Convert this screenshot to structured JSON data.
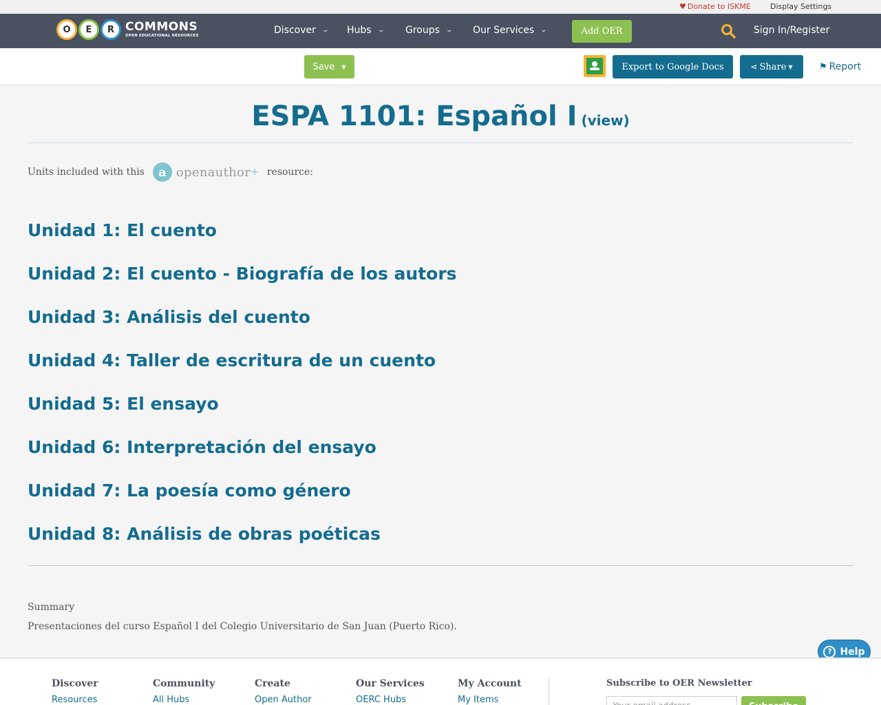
{
  "utility": {
    "donate": "Donate to ISKME",
    "display_settings": "Display Settings"
  },
  "logo": {
    "letters": [
      "O",
      "E",
      "R"
    ],
    "wordmark": "COMMONS",
    "tagline": "OPEN EDUCATIONAL RESOURCES"
  },
  "nav": {
    "items": [
      {
        "label": "Discover"
      },
      {
        "label": "Hubs"
      },
      {
        "label": "Groups"
      },
      {
        "label": "Our Services"
      }
    ],
    "add_oer": "Add OER",
    "signin": "Sign In/Register"
  },
  "toolbar": {
    "save": "Save",
    "export": "Export to Google Docs",
    "share": "Share",
    "report": "Report"
  },
  "page": {
    "title": "ESPA 1101: Español I",
    "view_link": "(view)",
    "units_intro_before": "Units included with this",
    "openauthor_brand": "openauthor",
    "units_intro_after": "resource:",
    "units": [
      "Unidad 1: El cuento",
      "Unidad 2: El cuento - Biografía de los autors",
      "Unidad 3: Análisis del cuento",
      "Unidad 4: Taller de escritura de un cuento",
      "Unidad 5: El ensayo",
      "Unidad 6: Interpretación del ensayo",
      "Unidad 7: La poesía como género",
      "Unidad 8: Análisis de obras poéticas"
    ],
    "summary_label": "Summary",
    "summary_text": "Presentaciones del curso Español I del Colegio Universitario de San Juan (Puerto Rico)."
  },
  "help": "Help",
  "footer": {
    "columns": [
      {
        "heading": "Discover",
        "link": "Resources"
      },
      {
        "heading": "Community",
        "link": "All Hubs"
      },
      {
        "heading": "Create",
        "link": "Open Author"
      },
      {
        "heading": "Our Services",
        "link": "OERC Hubs"
      },
      {
        "heading": "My Account",
        "link": "My Items"
      }
    ],
    "newsletter_heading": "Subscribe to OER Newsletter",
    "newsletter_placeholder": "Your email address",
    "subscribe": "Subscribe"
  },
  "colors": {
    "nav_bg": "#4a5160",
    "brand_blue": "#146c8f",
    "brand_green": "#8cc152",
    "donate_red": "#c0392b"
  }
}
